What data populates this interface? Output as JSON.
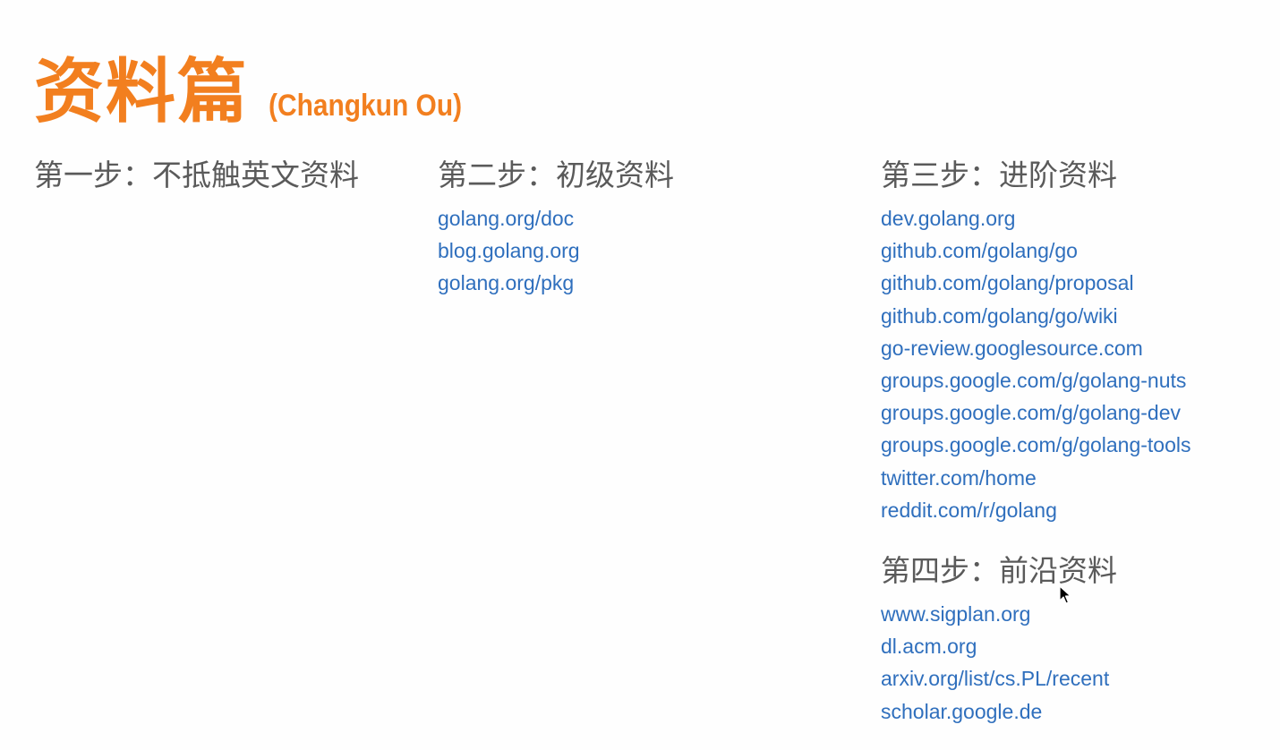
{
  "title": {
    "main": "资料篇",
    "author": "(Changkun Ou)"
  },
  "step1": {
    "heading": "第一步：不抵触英文资料",
    "links": []
  },
  "step2": {
    "heading": "第二步：初级资料",
    "links": [
      "golang.org/doc",
      "blog.golang.org",
      "golang.org/pkg"
    ]
  },
  "step3": {
    "heading": "第三步：进阶资料",
    "links": [
      "dev.golang.org",
      "github.com/golang/go",
      "github.com/golang/proposal",
      "github.com/golang/go/wiki",
      "go-review.googlesource.com",
      "groups.google.com/g/golang-nuts",
      "groups.google.com/g/golang-dev",
      "groups.google.com/g/golang-tools",
      "twitter.com/home",
      "reddit.com/r/golang"
    ]
  },
  "step4": {
    "heading": "第四步：前沿资料",
    "links": [
      "www.sigplan.org",
      "dl.acm.org",
      "arxiv.org/list/cs.PL/recent",
      "scholar.google.de"
    ]
  },
  "colors": {
    "title": "#f27f1f",
    "heading": "#5a5a5a",
    "link": "#2f6fbd"
  },
  "icons": {
    "cursor": "mouse-pointer-icon"
  }
}
